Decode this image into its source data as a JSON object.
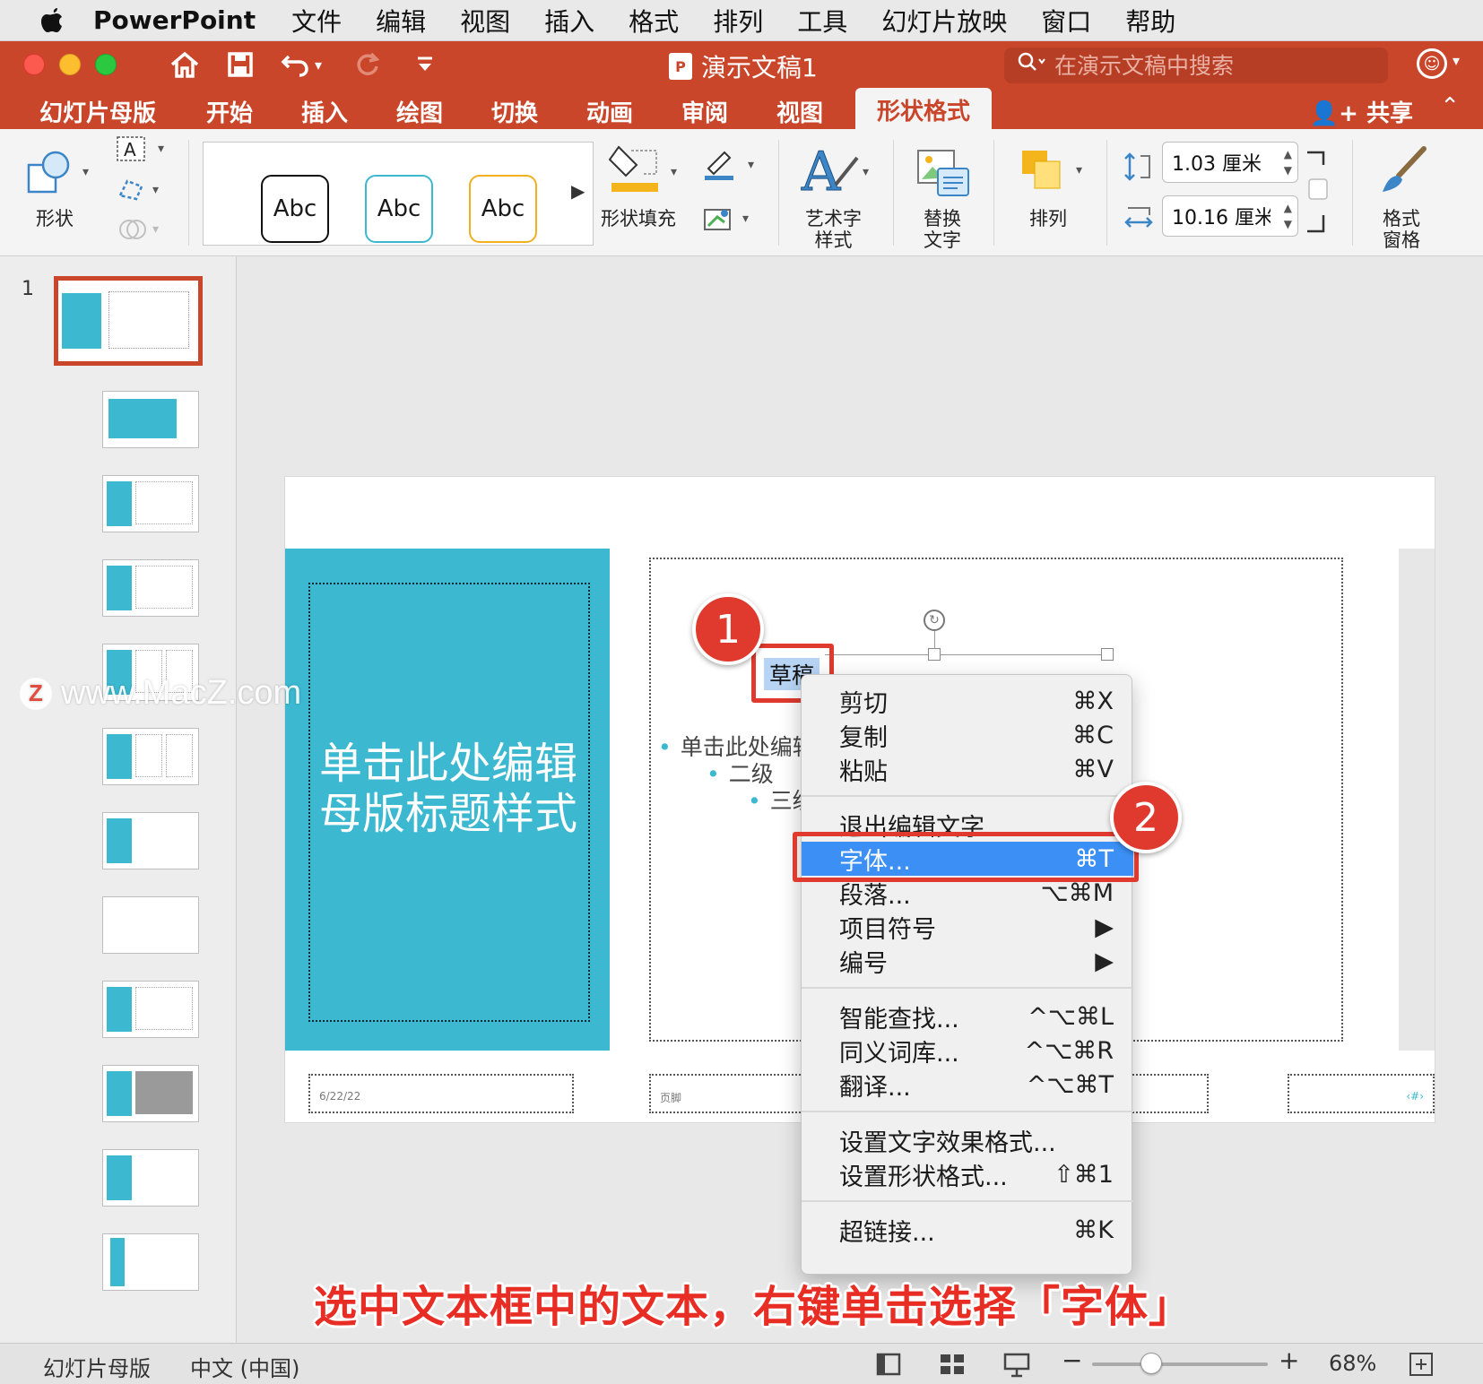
{
  "menubar": {
    "app_name": "PowerPoint",
    "items": [
      "文件",
      "编辑",
      "视图",
      "插入",
      "格式",
      "排列",
      "工具",
      "幻灯片放映",
      "窗口",
      "帮助"
    ]
  },
  "window": {
    "doc_title": "演示文稿1",
    "search_placeholder": "在演示文稿中搜索"
  },
  "ribbon_tabs": [
    "幻灯片母版",
    "开始",
    "插入",
    "绘图",
    "切换",
    "动画",
    "审阅",
    "视图",
    "形状格式"
  ],
  "ribbon_active_tab": "形状格式",
  "share_label": "共享",
  "ribbon": {
    "shape_label": "形状",
    "style_samples": [
      "Abc",
      "Abc",
      "Abc"
    ],
    "fill_label": "形状填充",
    "wordart_label": "艺术字\n样式",
    "alt_text_label": "替换\n文字",
    "arrange_label": "排列",
    "height_value": "1.03 厘米",
    "width_value": "10.16 厘米",
    "format_pane_label": "格式\n窗格"
  },
  "thumbs": {
    "first_number": "1",
    "count": 12
  },
  "slide": {
    "title_text": "单击此处编辑母版标题样式",
    "bullet_1": "单击此处编辑",
    "bullet_2": "二级",
    "bullet_3": "三级",
    "selected_text": "草稿",
    "date": "6/22/22",
    "footer": "页脚",
    "page_num": "‹#›"
  },
  "context_menu": {
    "items": [
      {
        "label": "剪切",
        "shortcut": "⌘X"
      },
      {
        "label": "复制",
        "shortcut": "⌘C"
      },
      {
        "label": "粘贴",
        "shortcut": "⌘V"
      },
      {
        "label": "退出编辑文字",
        "shortcut": ""
      },
      {
        "label": "字体...",
        "shortcut": "⌘T"
      },
      {
        "label": "段落...",
        "shortcut": "⌥⌘M"
      },
      {
        "label": "项目符号",
        "shortcut": "▶"
      },
      {
        "label": "编号",
        "shortcut": "▶"
      },
      {
        "label": "智能查找...",
        "shortcut": "^⌥⌘L"
      },
      {
        "label": "同义词库...",
        "shortcut": "^⌥⌘R"
      },
      {
        "label": "翻译...",
        "shortcut": "^⌥⌘T"
      },
      {
        "label": "设置文字效果格式...",
        "shortcut": ""
      },
      {
        "label": "设置形状格式...",
        "shortcut": "⇧⌘1"
      },
      {
        "label": "超链接...",
        "shortcut": "⌘K"
      }
    ],
    "highlighted": "字体..."
  },
  "badges": [
    "1",
    "2"
  ],
  "watermark": "www.MacZ.com",
  "watermark_logo": "Z",
  "caption": "选中文本框中的文本，右键单击选择「字体」",
  "statusbar": {
    "view_name": "幻灯片母版",
    "language": "中文 (中国)",
    "zoom": "68%",
    "zoom_minus": "−",
    "zoom_plus": "+"
  },
  "colors": {
    "accent": "#c9462b",
    "slide_blue": "#3cb8d0",
    "highlight": "#e03a2e",
    "menu_highlight": "#3b8ff5"
  }
}
